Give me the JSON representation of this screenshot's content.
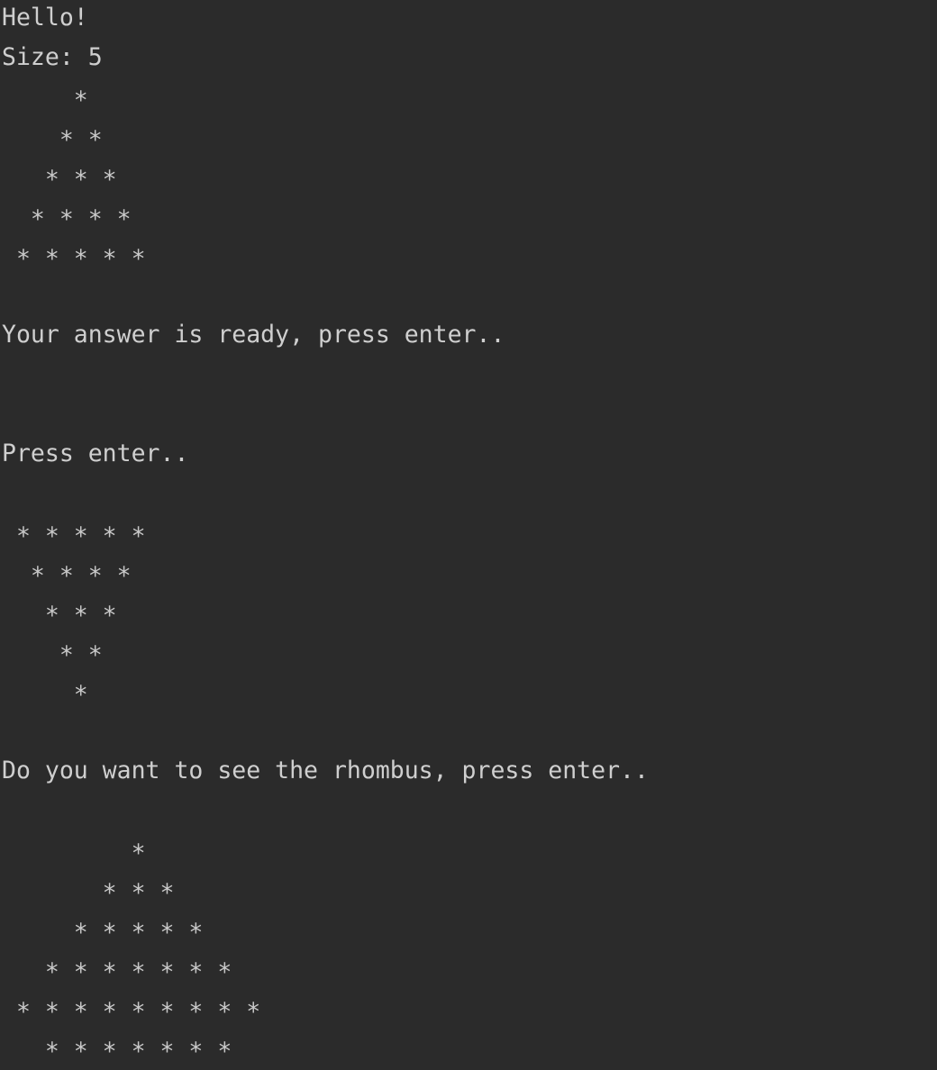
{
  "console": {
    "colors": {
      "background": "#2b2b2b",
      "text": "#cfcfcf"
    },
    "lines": [
      "Hello!",
      "Size: 5",
      "     *",
      "    * *",
      "   * * *",
      "  * * * *",
      " * * * * *",
      "",
      "Your answer is ready, press enter..",
      "",
      "",
      "Press enter..",
      "",
      " * * * * *",
      "  * * * *",
      "   * * *",
      "    * *",
      "     *",
      "",
      "Do you want to see the rhombus, press enter..",
      "",
      "         *",
      "       * * *",
      "     * * * * *",
      "   * * * * * * *",
      " * * * * * * * * *",
      "   * * * * * * *"
    ]
  }
}
